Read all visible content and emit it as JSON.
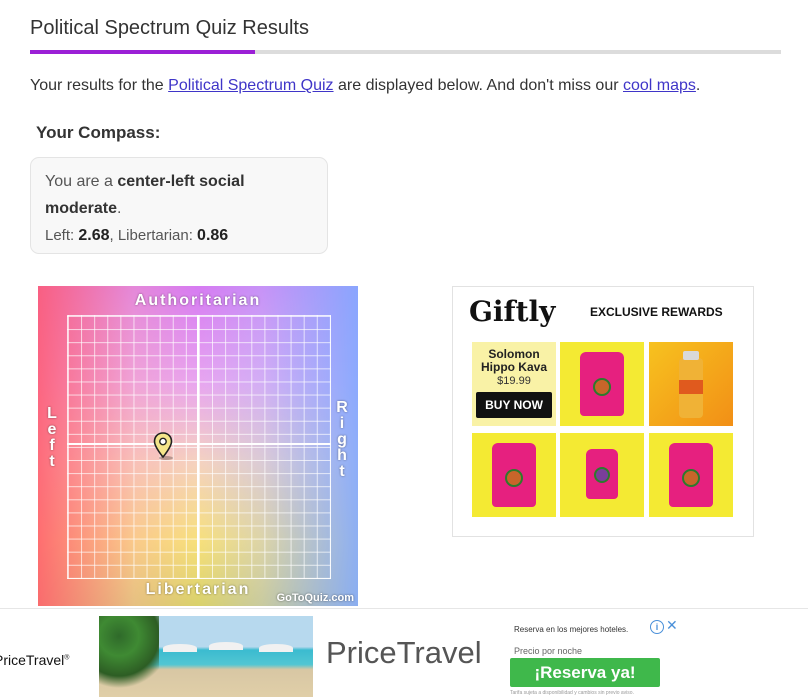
{
  "page": {
    "title": "Political Spectrum Quiz Results",
    "accent_color": "#9b1fd6"
  },
  "intro": {
    "prefix": "Your results for the ",
    "quiz_link": "Political Spectrum Quiz",
    "middle": " are displayed below. And don't miss our ",
    "maps_link": "cool maps",
    "suffix": "."
  },
  "compass_section": {
    "heading": "Your Compass:",
    "you_are": "You are a ",
    "result": "center-left social moderate",
    "period": ".",
    "left_label": "Left: ",
    "left_value": "2.68",
    "separator": ", Libertarian: ",
    "libertarian_value": "0.86"
  },
  "compass_chart": {
    "labels": {
      "top": "Authoritarian",
      "bottom": "Libertarian",
      "left": "Left",
      "right": "Right"
    },
    "watermark": "GoToQuiz.com",
    "grid_cells": 20,
    "marker": {
      "left_score": 2.68,
      "libertarian_score": 0.86
    }
  },
  "sidebar_ad": {
    "brand": "Giftly",
    "tagline": "EXCLUSIVE REWARDS",
    "product_name": "Solomon Hippo Kava",
    "product_price": "$19.99",
    "buy_label": "BUY NOW"
  },
  "bottom_ad": {
    "left_brand": "PriceTravel",
    "brand": "PriceTravel",
    "promo": "Reserva en los mejores hoteles.",
    "sub": "Precio por noche",
    "cta": "¡Reserva ya!",
    "fine_print": "Tarifa sujeta a disponibilidad y cambios sin previo aviso.",
    "info_icon": "info-icon",
    "close_icon": "close-icon"
  }
}
